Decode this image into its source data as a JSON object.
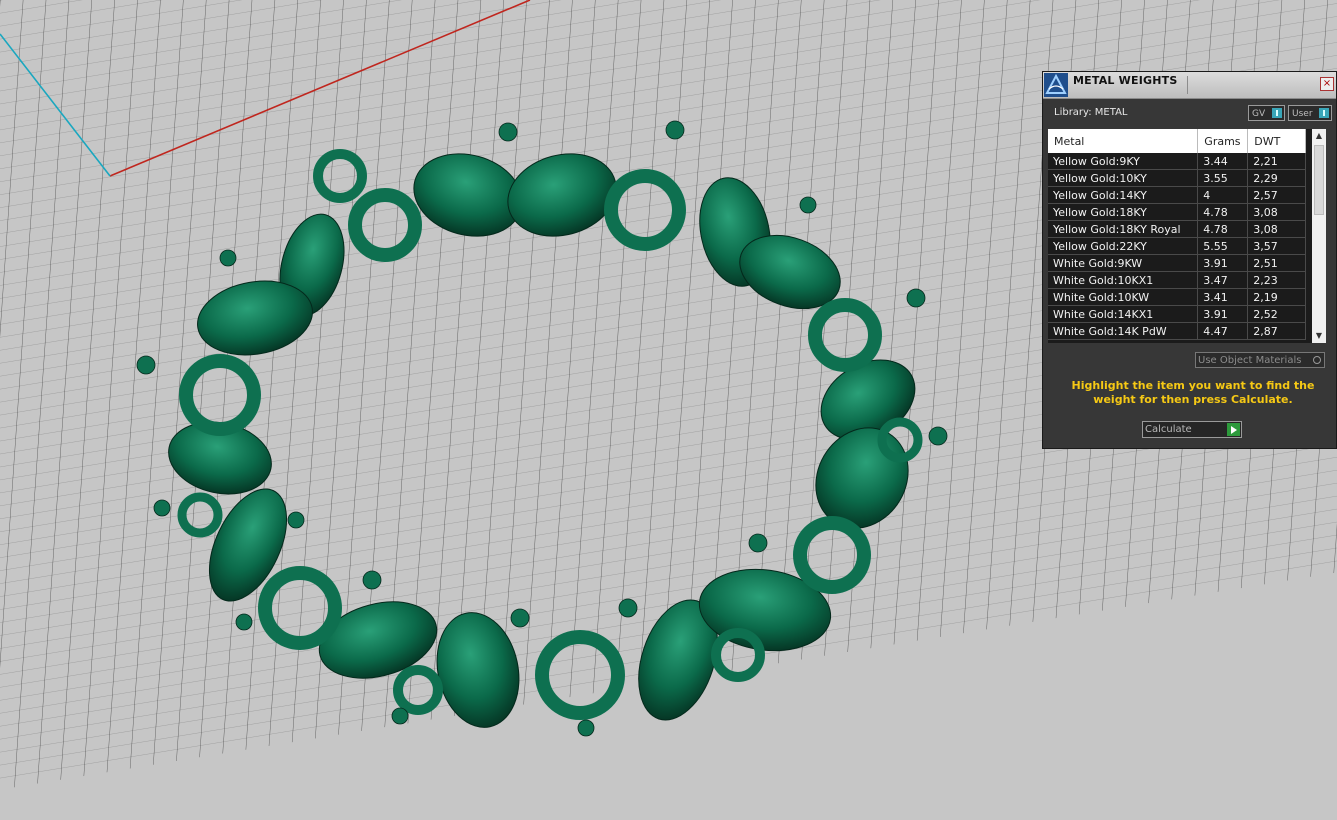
{
  "panel": {
    "title": "METAL WEIGHTS",
    "close_glyph": "×",
    "library_label": "Library: METAL",
    "toggles": [
      {
        "label": "GV",
        "state": "on"
      },
      {
        "label": "User",
        "state": "on"
      }
    ],
    "columns": [
      "Metal",
      "Grams",
      "DWT"
    ],
    "rows": [
      [
        "Yellow Gold:9KY",
        "3.44",
        "2,21"
      ],
      [
        "Yellow Gold:10KY",
        "3.55",
        "2,29"
      ],
      [
        "Yellow Gold:14KY",
        "4",
        "2,57"
      ],
      [
        "Yellow Gold:18KY",
        "4.78",
        "3,08"
      ],
      [
        "Yellow Gold:18KY Royal",
        "4.78",
        "3,08"
      ],
      [
        "Yellow Gold:22KY",
        "5.55",
        "3,57"
      ],
      [
        "White Gold:9KW",
        "3.91",
        "2,51"
      ],
      [
        "White Gold:10KX1",
        "3.47",
        "2,23"
      ],
      [
        "White Gold:10KW",
        "3.41",
        "2,19"
      ],
      [
        "White Gold:14KX1",
        "3.91",
        "2,52"
      ],
      [
        "White Gold:14K PdW",
        "4.47",
        "2,87"
      ]
    ],
    "use_object_materials": "Use Object Materials",
    "hint": "Highlight the item you want to find the weight for then press Calculate.",
    "calculate_label": "Calculate",
    "hint_color": "#f6c915",
    "model_color": "#0b6a4a"
  },
  "icons": {
    "logo": "app-logo-icon",
    "close": "close-icon",
    "scroll_up": "scroll-up-icon",
    "scroll_down": "scroll-down-icon",
    "calculate": "play-icon"
  }
}
